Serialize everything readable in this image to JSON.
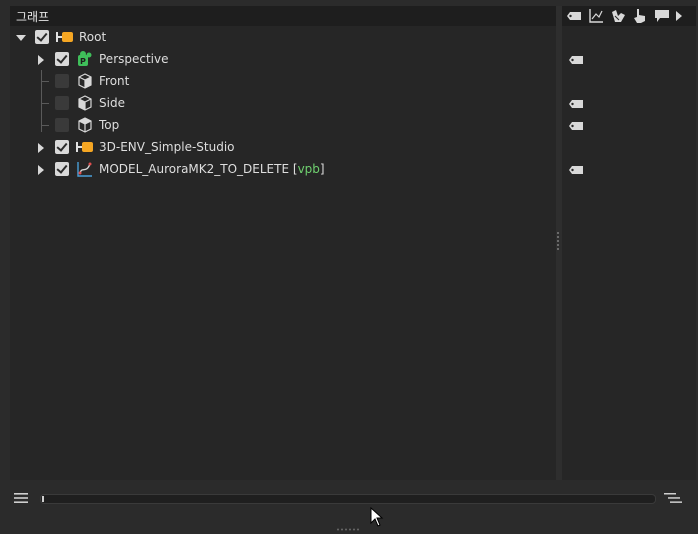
{
  "header": {
    "title": "그래프"
  },
  "tree": {
    "root": {
      "label": "Root",
      "checked": true,
      "icon": "null-object-orange-icon"
    },
    "items": [
      {
        "label": "Perspective",
        "checked": true,
        "expandable": true,
        "icon": "camera-perspective-icon",
        "tagged": true
      },
      {
        "label": "Front",
        "checked": false,
        "expandable": false,
        "icon": "camera-front-cube-icon",
        "tagged": false
      },
      {
        "label": "Side",
        "checked": false,
        "expandable": false,
        "icon": "camera-side-cube-icon",
        "tagged": true
      },
      {
        "label": "Top",
        "checked": false,
        "expandable": false,
        "icon": "camera-top-cube-icon",
        "tagged": true
      },
      {
        "label": "3D-ENV_Simple-Studio",
        "checked": true,
        "expandable": true,
        "icon": "null-object-orange-icon",
        "tagged": false
      },
      {
        "label": "MODEL_AuroraMK2_TO_DELETE",
        "tag_label": "vpb",
        "checked": true,
        "expandable": true,
        "icon": "spline-model-icon",
        "tagged": true
      }
    ]
  },
  "right_toolbar": {
    "icons": [
      "tag-icon",
      "graph-axes-icon",
      "hand-arrow-icon",
      "pointer-hand-icon",
      "speech-bubble-icon",
      "play-arrow-icon"
    ]
  },
  "bottom": {
    "menu_icon": "hamburger-menu-icon",
    "filter_icon": "align-right-lines-icon"
  },
  "colors": {
    "accent_orange": "#f5a623",
    "tag_green": "#6fd06f",
    "camera_green": "#3fbf5a"
  }
}
